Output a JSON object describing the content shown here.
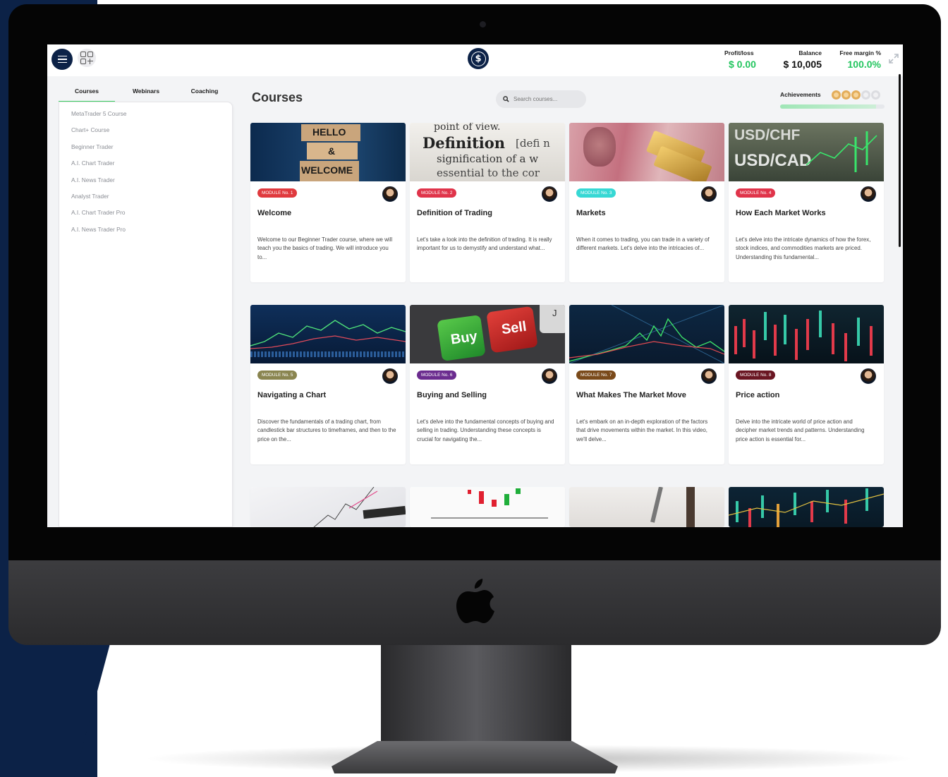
{
  "header": {
    "profit_loss_label": "Profit/loss",
    "profit_loss_value": "$ 0.00",
    "balance_label": "Balance",
    "balance_value": "$ 10,005",
    "free_margin_label": "Free margin %",
    "free_margin_value": "100.0%",
    "logo_symbol": "$",
    "colors": {
      "positive": "#22c55e",
      "neutral": "#111111",
      "brand": "#0c2247"
    }
  },
  "sidebar": {
    "tabs": [
      {
        "label": "Courses",
        "active": true
      },
      {
        "label": "Webinars",
        "active": false
      },
      {
        "label": "Coaching",
        "active": false
      }
    ],
    "items": [
      "MetaTrader 5 Course",
      "Chart+ Course",
      "Beginner Trader",
      "A.I. Chart Trader",
      "A.I. News Trader",
      "Analyst Trader",
      "A.I. Chart Trader Pro",
      "A.I. News Trader Pro"
    ]
  },
  "main": {
    "title": "Courses",
    "search_placeholder": "Search courses...",
    "achievements_label": "Achievements",
    "achievements_earned": 3,
    "achievements_total": 5,
    "achievements_progress": 0.92,
    "cards": [
      {
        "badge": "MODULE No. 1",
        "badge_color": "#e03a3e",
        "title": "Welcome",
        "desc": "Welcome to our Beginner Trader course, where we will teach you the basics of trading. We will introduce you to...",
        "thumb": "hello-welcome"
      },
      {
        "badge": "MODULE No. 2",
        "badge_color": "#e0344a",
        "title": "Definition of Trading",
        "desc": "Let's take a look into the definition of trading. It is really important for us to demystify and understand what...",
        "thumb": "definition"
      },
      {
        "badge": "MODULE No. 3",
        "badge_color": "#37d8d4",
        "title": "Markets",
        "desc": "When it comes to trading, you can trade in a variety of different markets. Let's delve into the intricacies of...",
        "thumb": "currency-gold"
      },
      {
        "badge": "MODULE No. 4",
        "badge_color": "#e0344a",
        "title": "How Each Market Works",
        "desc": "Let's delve into the intricate dynamics of how the forex, stock indices, and commodities markets are priced. Understanding this fundamental...",
        "thumb": "usd-chf-cad"
      },
      {
        "badge": "MODULE No. 5",
        "badge_color": "#8a8550",
        "title": "Navigating a Chart",
        "desc": "Discover the fundamentals of a trading chart, from candlestick bar structures to timeframes, and then to the price on the...",
        "thumb": "chart-blue"
      },
      {
        "badge": "MODULE No. 6",
        "badge_color": "#6b2c8f",
        "title": "Buying and Selling",
        "desc": "Let's delve into the fundamental concepts of buying and selling in trading. Understanding these concepts is crucial for navigating the...",
        "thumb": "buy-sell-keys"
      },
      {
        "badge": "MODULE No. 7",
        "badge_color": "#7a4a1a",
        "title": "What Makes The Market Move",
        "desc": "Let's embark on an in-depth exploration of the factors that drive movements within the market. In this video, we'll delve...",
        "thumb": "chart-dark"
      },
      {
        "badge": "MODULE No. 8",
        "badge_color": "#6a1622",
        "title": "Price action",
        "desc": "Delve into the intricate world of price action and decipher market trends and patterns. Understanding price action is essential for...",
        "thumb": "candles-dark"
      }
    ],
    "keys_text": {
      "buy": "Buy",
      "sell": "Sell",
      "key_letter": "J"
    },
    "thumb_text": {
      "hello": "HELLO",
      "amp": "&",
      "welcome": "WELCOME",
      "pov": "point of view.",
      "definition": "Definition",
      "defn": "[defi n",
      "signification": "signification of a w",
      "essential": "essential to the cor",
      "usd_chf": "USD/CHF",
      "usd_cad": "USD/CAD"
    }
  }
}
